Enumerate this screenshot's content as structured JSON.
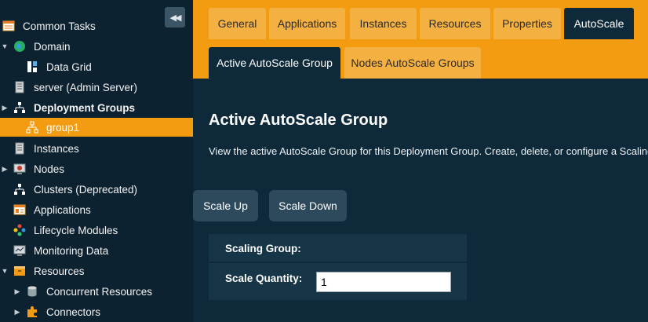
{
  "sidebar": {
    "collapse_glyph": "◀◀",
    "items": [
      {
        "label": "Common Tasks",
        "icon": "common-tasks-icon"
      },
      {
        "label": "Domain",
        "icon": "domain-globe-icon"
      },
      {
        "label": "Data Grid",
        "icon": "data-grid-icon"
      },
      {
        "label": "server (Admin Server)",
        "icon": "server-icon"
      },
      {
        "label": "Deployment Groups",
        "icon": "deployment-groups-icon"
      },
      {
        "label": "group1",
        "icon": "group-icon"
      },
      {
        "label": "Instances",
        "icon": "instances-icon"
      },
      {
        "label": "Nodes",
        "icon": "nodes-icon"
      },
      {
        "label": "Clusters (Deprecated)",
        "icon": "clusters-icon"
      },
      {
        "label": "Applications",
        "icon": "applications-icon"
      },
      {
        "label": "Lifecycle Modules",
        "icon": "lifecycle-modules-icon"
      },
      {
        "label": "Monitoring Data",
        "icon": "monitoring-data-icon"
      },
      {
        "label": "Resources",
        "icon": "resources-icon"
      },
      {
        "label": "Concurrent Resources",
        "icon": "concurrent-resources-icon"
      },
      {
        "label": "Connectors",
        "icon": "connectors-icon"
      }
    ]
  },
  "tabs": [
    {
      "label": "General"
    },
    {
      "label": "Applications"
    },
    {
      "label": "Instances"
    },
    {
      "label": "Resources"
    },
    {
      "label": "Properties"
    },
    {
      "label": "AutoScale"
    }
  ],
  "subtabs": [
    {
      "label": "Active AutoScale Group"
    },
    {
      "label": "Nodes AutoScale Groups"
    }
  ],
  "main": {
    "title": "Active AutoScale Group",
    "description": "View the active AutoScale Group for this Deployment Group. Create, delete, or configure a Scaling",
    "scale_up_label": "Scale Up",
    "scale_down_label": "Scale Down",
    "scaling_group_label": "Scaling Group:",
    "scale_quantity_label": "Scale Quantity:",
    "scale_quantity_value": "1"
  },
  "colors": {
    "accent": "#f39c12",
    "tab_inactive": "#f5b042",
    "content_bg": "#0e2a3a",
    "sidebar_bg": "#0d2230"
  }
}
